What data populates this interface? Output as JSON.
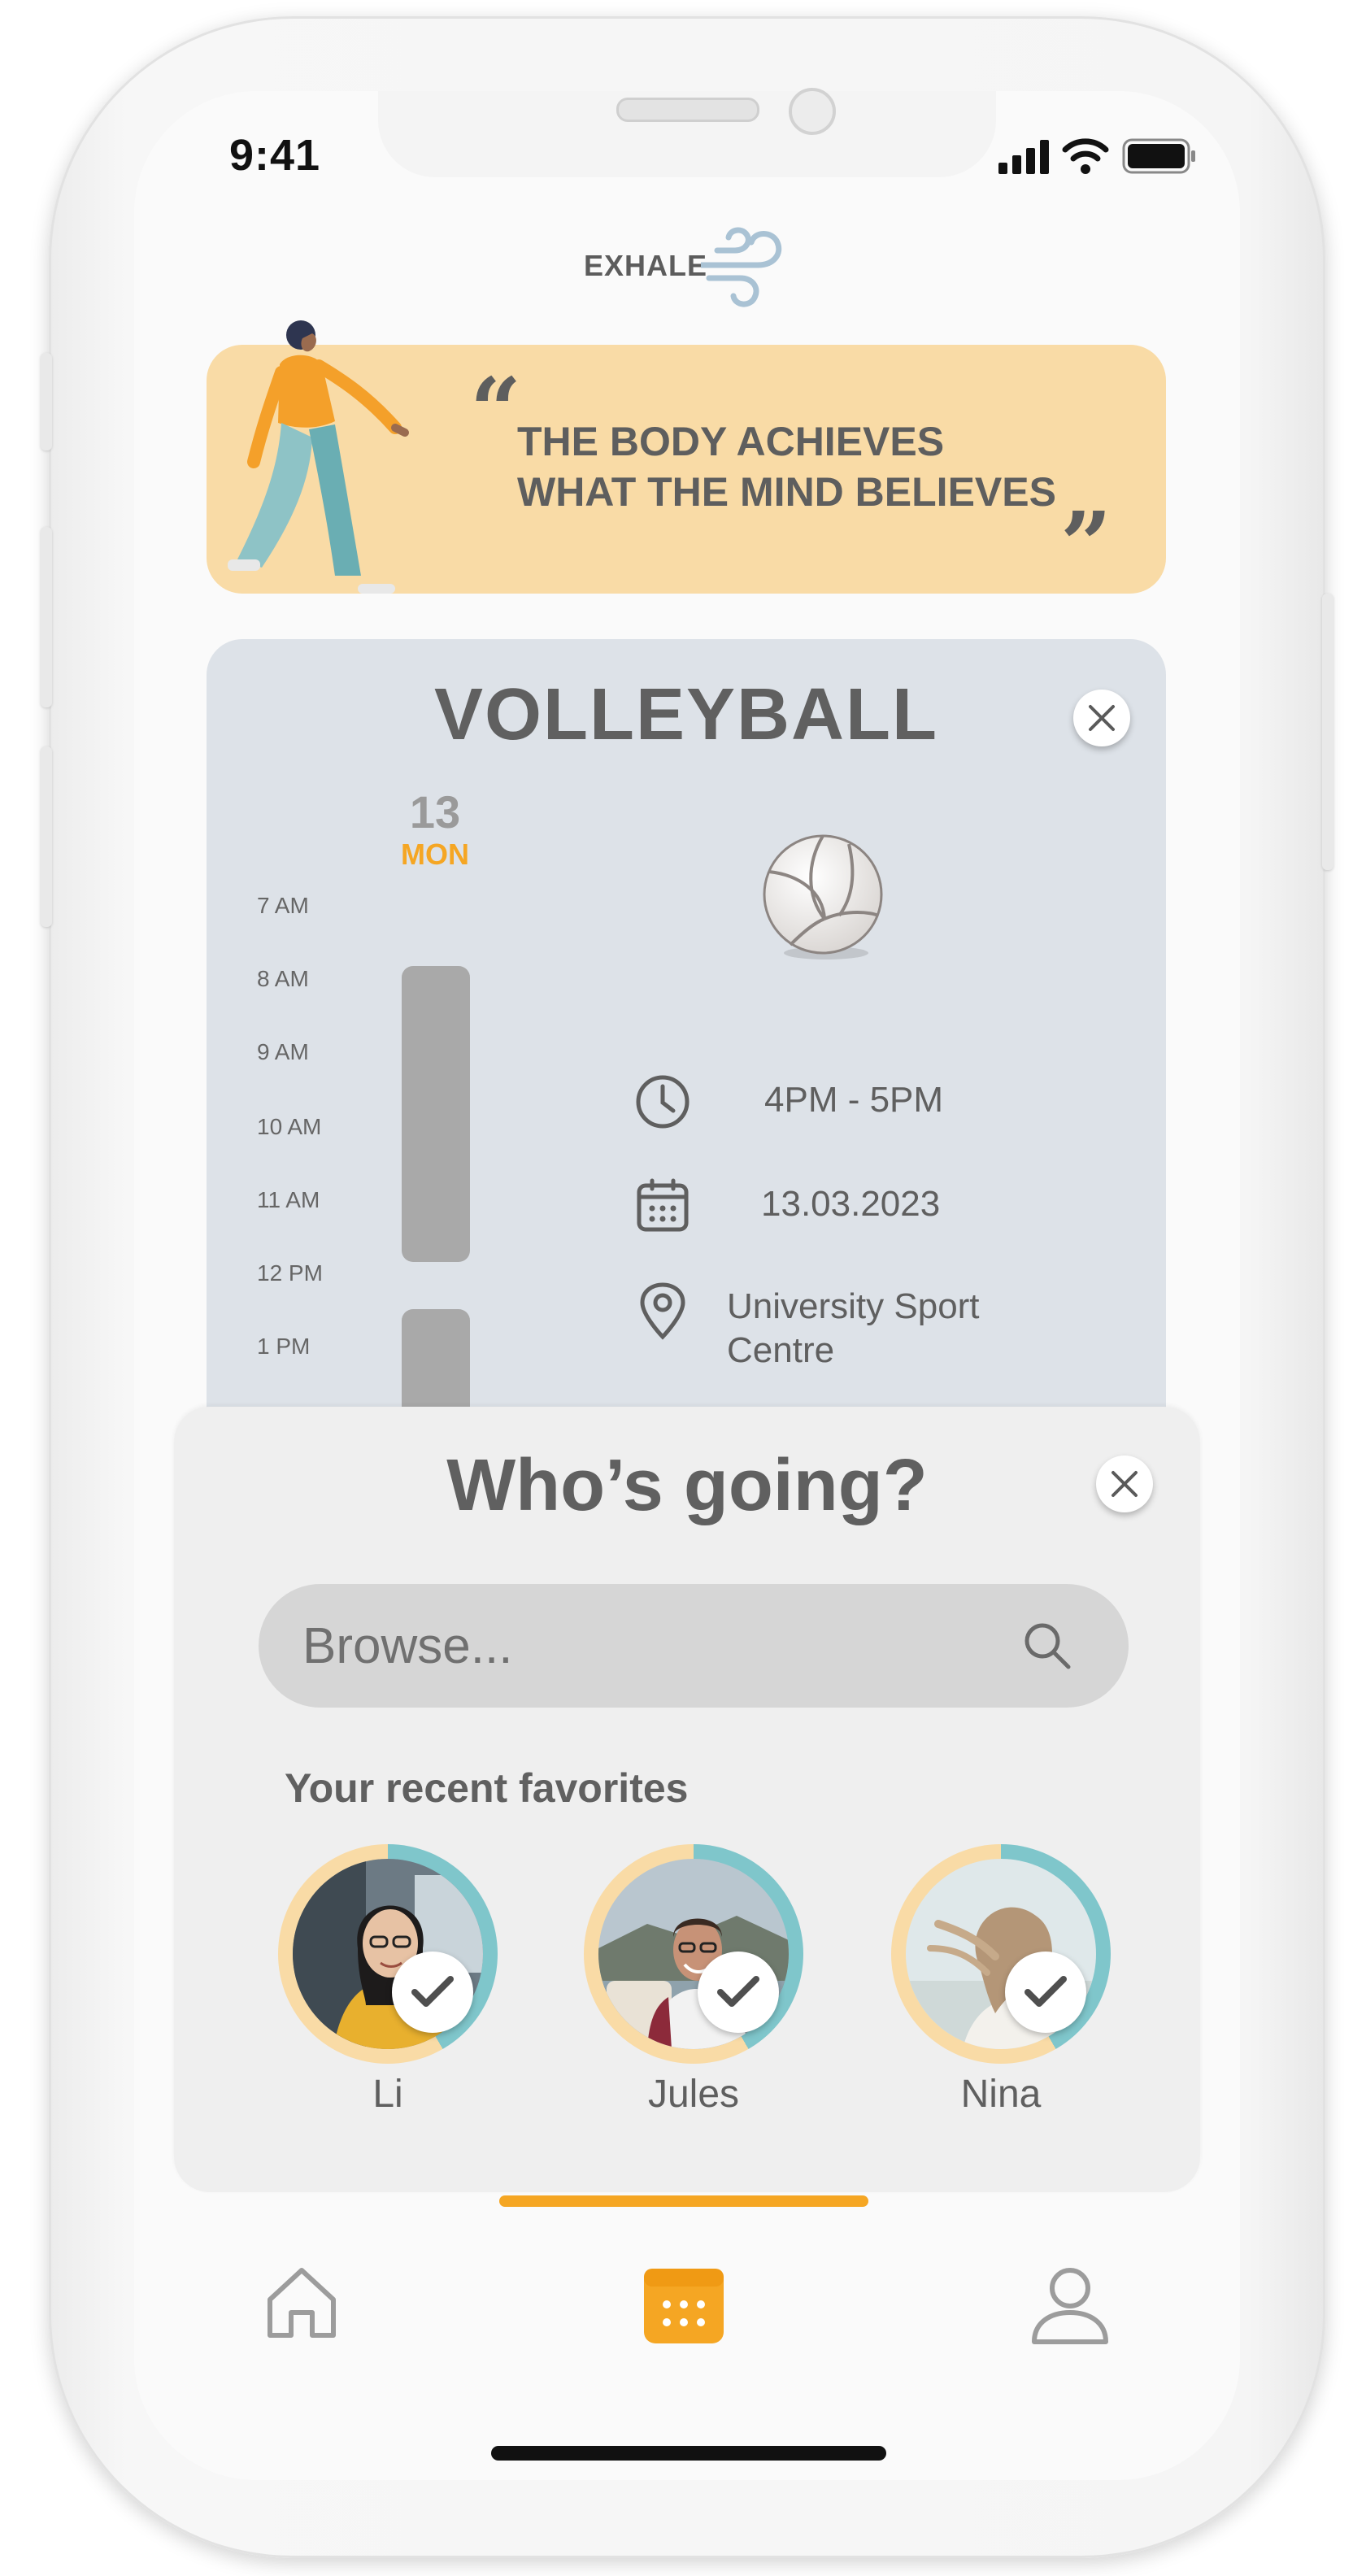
{
  "status_bar": {
    "time": "9:41"
  },
  "app": {
    "logo_text": "EXHALE"
  },
  "quote": {
    "text": "THE BODY ACHIEVES\nWHAT THE MIND BELIEVES",
    "open_mark": "“",
    "close_mark": "„"
  },
  "event": {
    "title": "VOLLEYBALL",
    "day_number": "13",
    "day_name": "MON",
    "time_labels": [
      "7 AM",
      "8 AM",
      "9 AM",
      "10 AM",
      "11 AM",
      "12 PM",
      "1 PM"
    ],
    "time_range": "4PM - 5PM",
    "date": "13.03.2023",
    "location_line1": "University Sport",
    "location_line2": "Centre"
  },
  "whos_going": {
    "title": "Who’s going?",
    "search_placeholder": "Browse...",
    "favorites_heading": "Your recent favorites",
    "friends": [
      {
        "name": "Li",
        "selected": true
      },
      {
        "name": "Jules",
        "selected": true
      },
      {
        "name": "Nina",
        "selected": true
      }
    ]
  },
  "nav": {
    "items": [
      {
        "icon": "home-icon"
      },
      {
        "icon": "calendar-icon",
        "active": true
      },
      {
        "icon": "profile-icon"
      }
    ]
  },
  "colors": {
    "accent": "#f5a623",
    "banner": "#f9dba6",
    "card": "#dde2e8",
    "sheet": "#efefef",
    "teal": "#7fc6cb"
  }
}
